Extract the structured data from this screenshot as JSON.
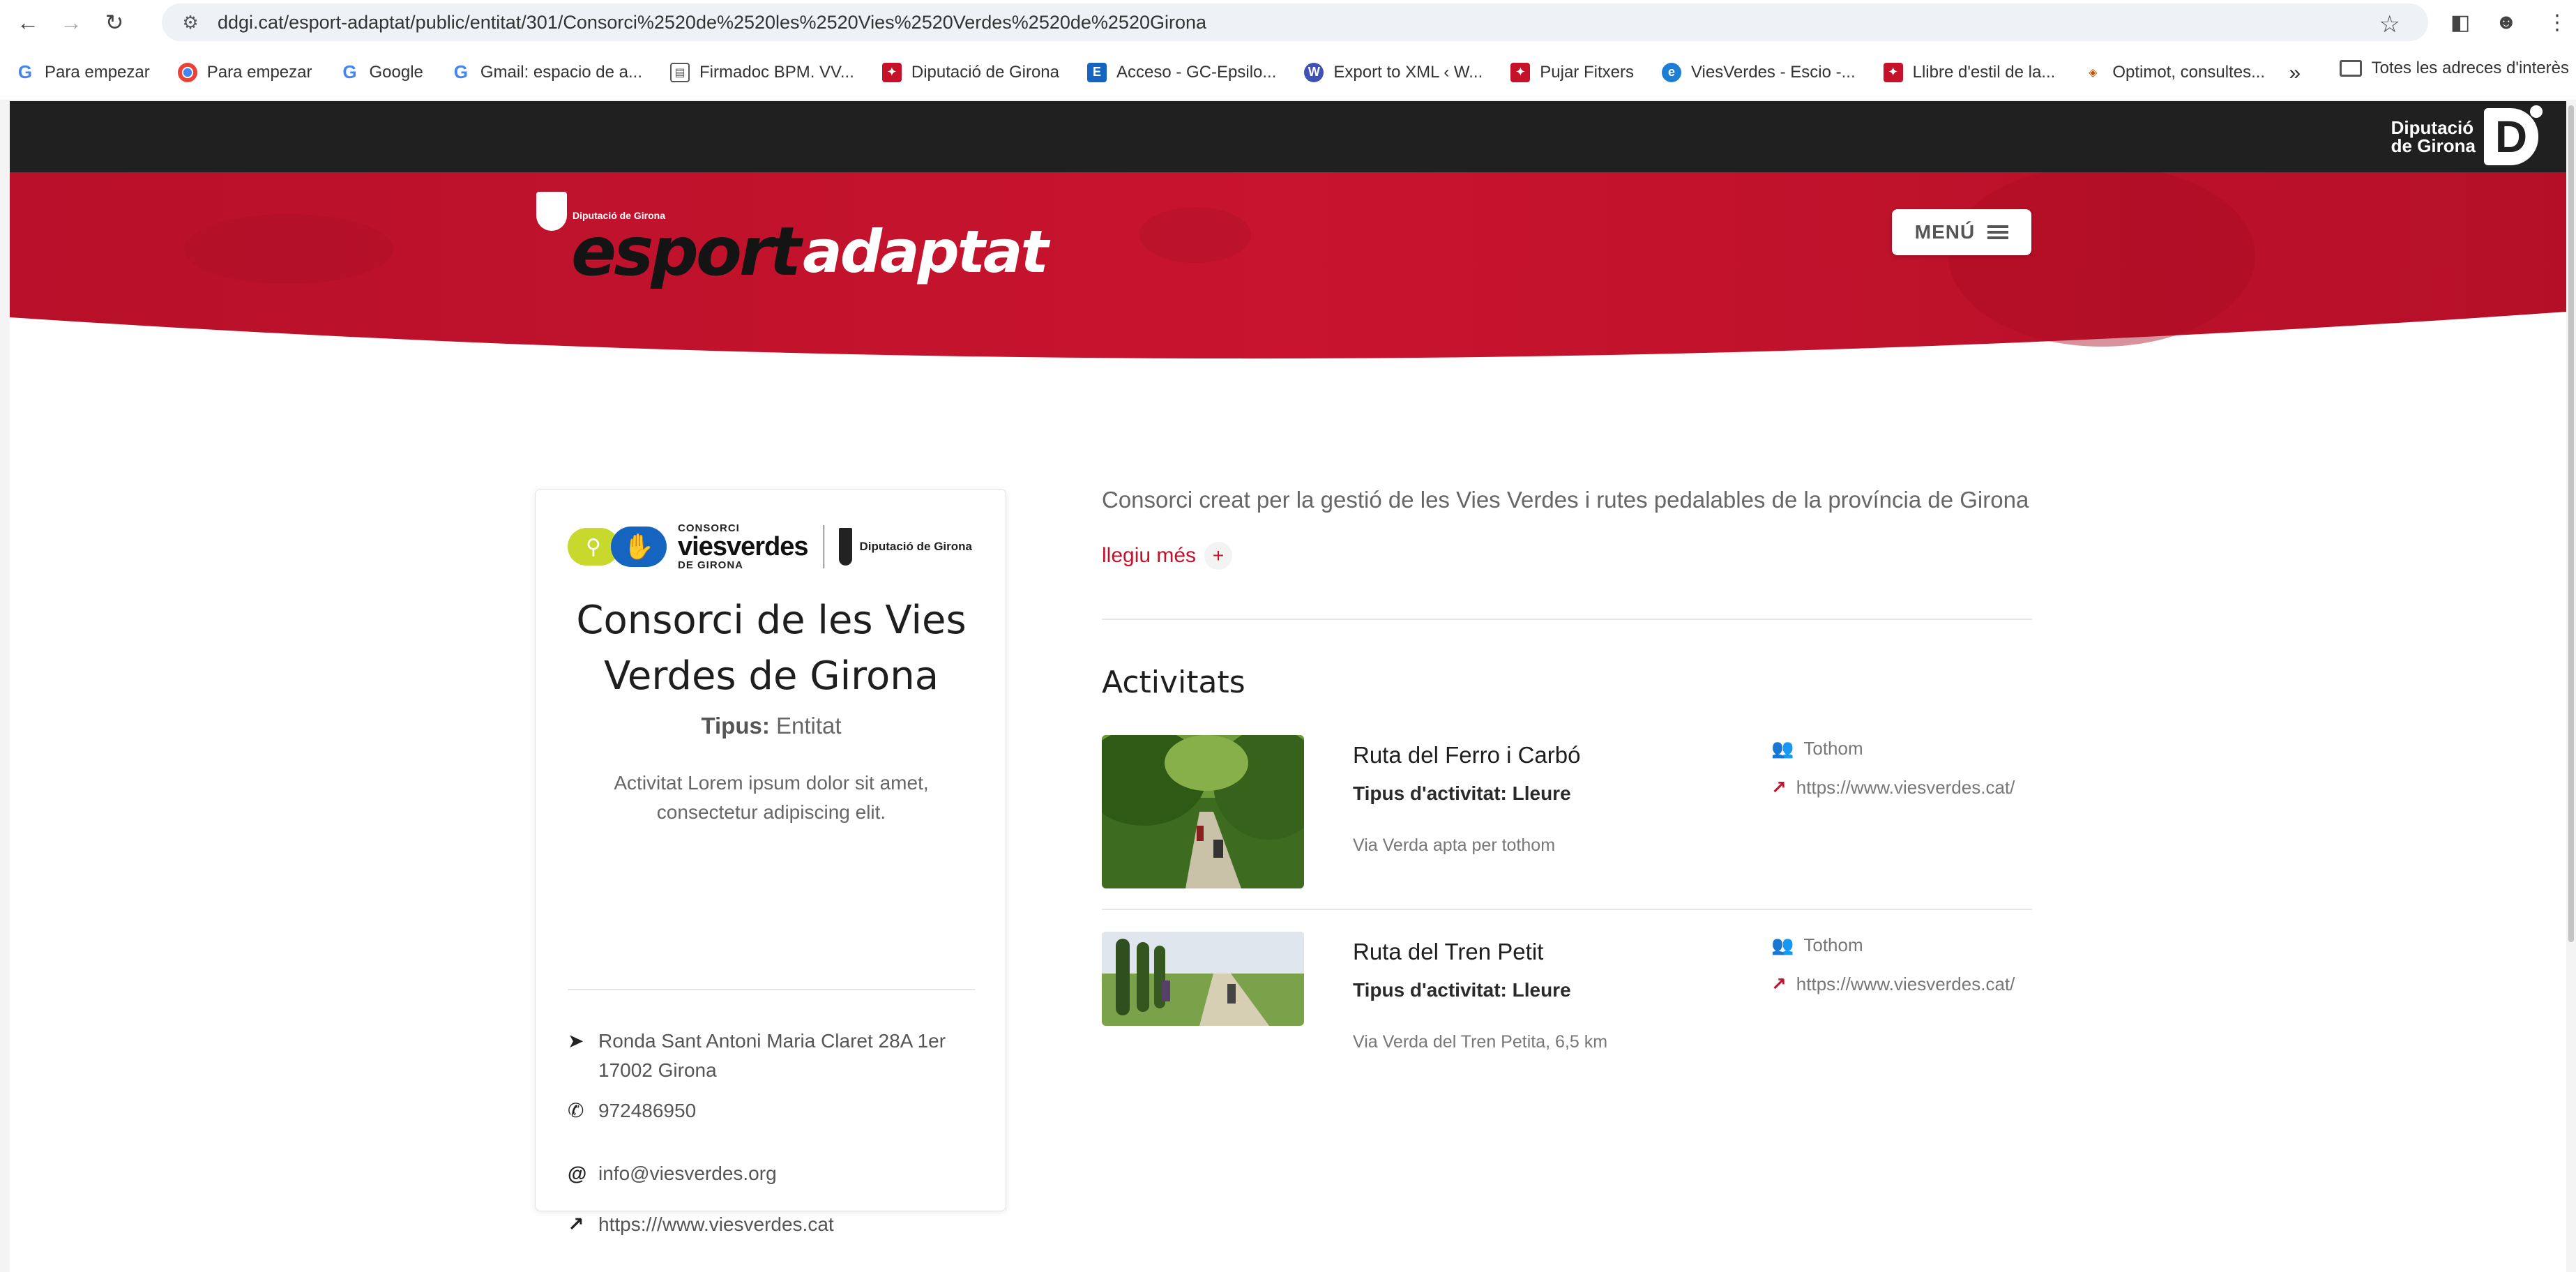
{
  "browser": {
    "url": "ddgi.cat/esport-adaptat/public/entitat/301/Consorci%2520de%2520les%2520Vies%2520Verdes%2520de%2520Girona",
    "bookmarks": [
      {
        "label": "Para empezar",
        "icon": "google-icon"
      },
      {
        "label": "Para empezar",
        "icon": "chrome-icon"
      },
      {
        "label": "Google",
        "icon": "google-icon"
      },
      {
        "label": "Gmail: espacio de a...",
        "icon": "google-icon"
      },
      {
        "label": "Firmadoc BPM. VV...",
        "icon": "document-icon"
      },
      {
        "label": "Diputació de Girona",
        "icon": "diputacio-icon"
      },
      {
        "label": "Acceso - GC-Epsilo...",
        "icon": "epsilon-icon"
      },
      {
        "label": "Export to XML ‹ W...",
        "icon": "wordpress-icon"
      },
      {
        "label": "Pujar Fitxers",
        "icon": "diputacio-icon"
      },
      {
        "label": "ViesVerdes - Escio -...",
        "icon": "viesverdes-icon"
      },
      {
        "label": "Llibre d'estil de la...",
        "icon": "diputacio-icon"
      },
      {
        "label": "Optimot, consultes...",
        "icon": "optimot-icon"
      }
    ],
    "bookmarks_folder": "Totes les adreces d'interès"
  },
  "header": {
    "dip_logo_line1": "Diputació",
    "dip_logo_line2": "de Girona",
    "brand_small": "Diputació de Girona",
    "brand_part1": "esport",
    "brand_part2": "adaptat",
    "menu_label": "MENÚ",
    "accent_color": "#c5112a"
  },
  "entity": {
    "logo": {
      "line1": "CONSORCI",
      "line2": "viesverdes",
      "line3": "DE GIRONA",
      "dip_label": "Diputació de Girona"
    },
    "title": "Consorci de les Vies Verdes de Girona",
    "type_label": "Tipus:",
    "type_value": "Entitat",
    "description": "Activitat Lorem ipsum dolor sit amet, consectetur adipiscing elit.",
    "address": "Ronda Sant Antoni Maria Claret 28A 1er 17002 Girona",
    "phone": "972486950",
    "email": "info@viesverdes.org",
    "website": "https:///www.viesverdes.cat"
  },
  "main": {
    "intro": "Consorci creat per la gestió de les Vies Verdes i rutes pedalables de la província de Girona",
    "read_more": "llegiu més",
    "activities_heading": "Activitats",
    "activities": [
      {
        "name": "Ruta del Ferro i Carbó",
        "type": "Tipus d'activitat: Lleure",
        "description": "Via Verda apta per tothom",
        "audience": "Tothom",
        "link": "https://www.viesverdes.cat/"
      },
      {
        "name": "Ruta del Tren Petit",
        "type": "Tipus d'activitat: Lleure",
        "description": "Via Verda del Tren Petita, 6,5 km",
        "audience": "Tothom",
        "link": "https://www.viesverdes.cat/"
      }
    ]
  }
}
